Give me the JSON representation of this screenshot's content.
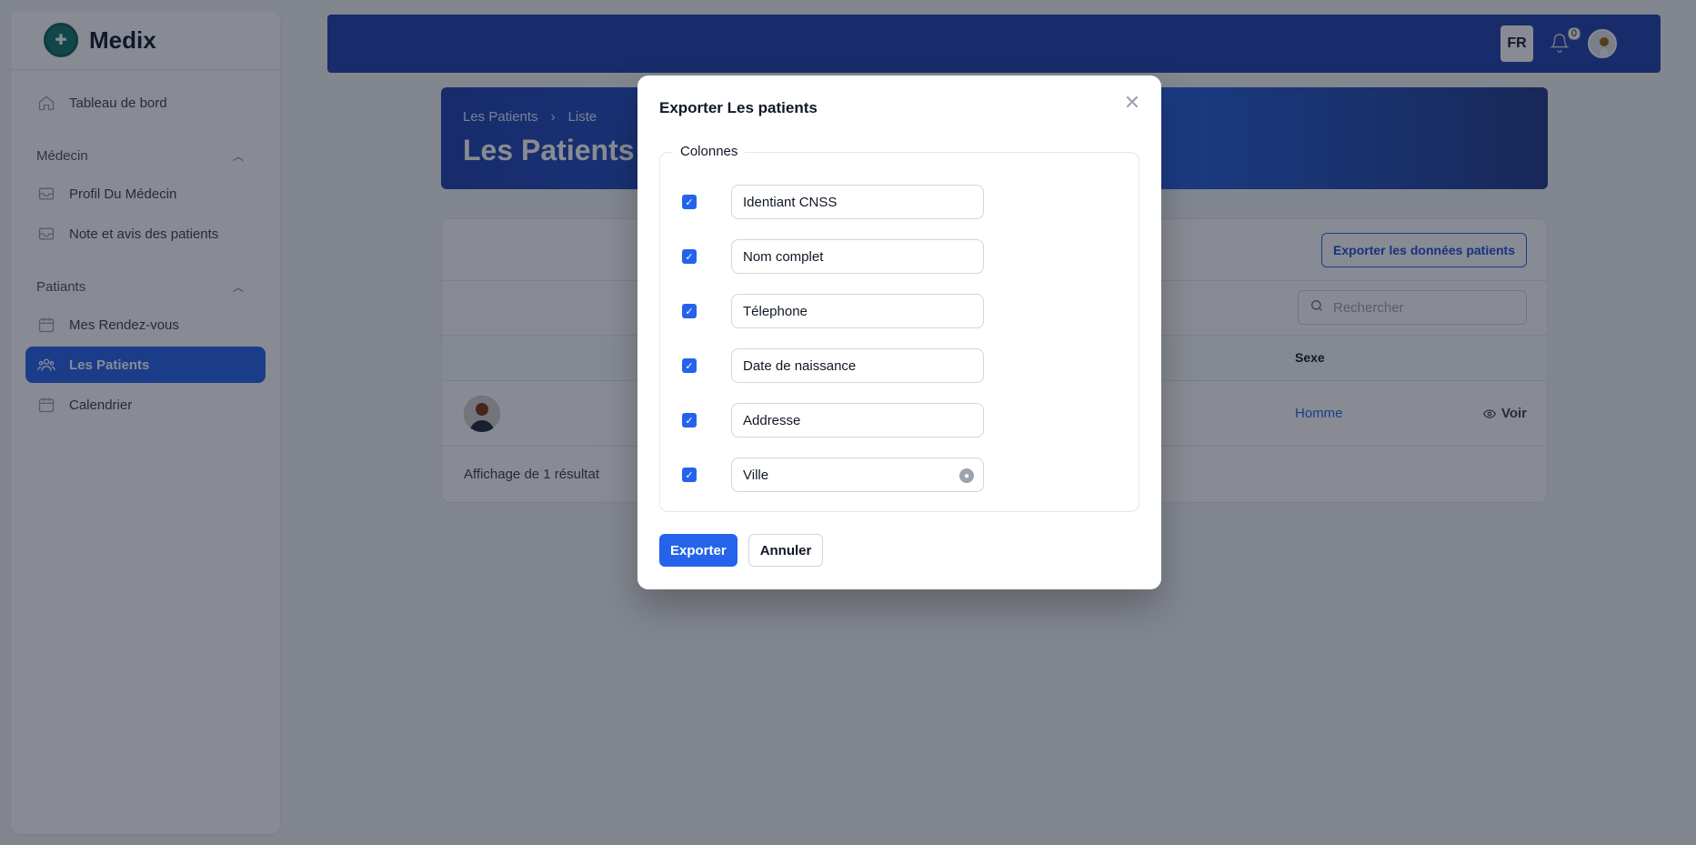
{
  "app": {
    "name": "Medix"
  },
  "sidebar": {
    "dashboard": "Tableau de bord",
    "groups": [
      {
        "label": "Médecin",
        "items": [
          "Profil Du Médecin",
          "Note et avis des patients"
        ]
      },
      {
        "label": "Patiants",
        "items": [
          "Mes Rendez-vous",
          "Les Patients",
          "Calendrier"
        ]
      }
    ],
    "active_item": "Les Patients"
  },
  "topbar": {
    "lang": "FR",
    "notifications_count": "0"
  },
  "hero": {
    "breadcrumb": [
      "Les Patients",
      "Liste"
    ],
    "title": "Les Patients"
  },
  "table": {
    "export_button": "Exporter les données patients",
    "search_placeholder": "Rechercher",
    "columns": [
      "Sexe"
    ],
    "rows": [
      {
        "sexe": "Homme",
        "action": "Voir"
      }
    ],
    "footer": "Affichage de 1 résultat"
  },
  "modal": {
    "title": "Exporter Les patients",
    "fieldset_legend": "Colonnes",
    "columns": [
      {
        "label": "Identiant CNSS",
        "checked": true
      },
      {
        "label": "Nom complet",
        "checked": true
      },
      {
        "label": "Télephone",
        "checked": true
      },
      {
        "label": "Date de naissance",
        "checked": true
      },
      {
        "label": "Addresse",
        "checked": true
      },
      {
        "label": "Ville",
        "checked": true
      }
    ],
    "submit": "Exporter",
    "cancel": "Annuler"
  },
  "colors": {
    "primary": "#2563eb",
    "header": "#1e40af",
    "overlay": "rgba(17,24,39,0.5)"
  }
}
